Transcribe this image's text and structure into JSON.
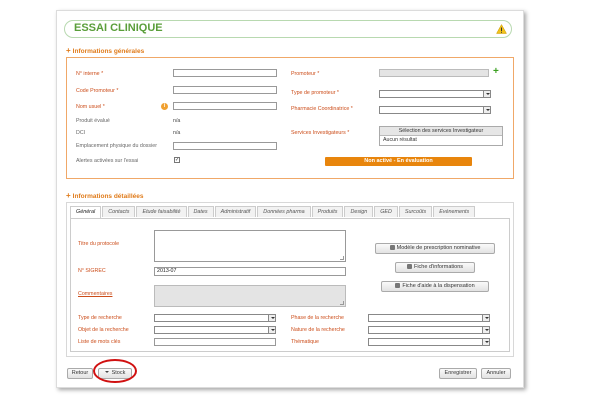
{
  "page": {
    "title": "ESSAI CLINIQUE"
  },
  "general": {
    "heading": "Informations générales",
    "left": {
      "num_interne_label": "N° interne *",
      "code_promoteur_label": "Code Promoteur *",
      "nom_usuel_label": "Nom usuel *",
      "produit_evalue_label": "Produit évalué",
      "produit_evalue_value": "n/a",
      "dci_label": "DCI",
      "dci_value": "n/a",
      "emplacement_label": "Emplacement physique du dossier",
      "alertes_label": "Alertes activées sur l'essai",
      "alertes_checked": true
    },
    "right": {
      "promoteur_label": "Promoteur *",
      "type_promoteur_label": "Type de promoteur *",
      "pharmacie_label": "Pharmacie Coordinatrice *",
      "services_label": "Services Investigateurs *",
      "services_table_header": "Sélection des services Investigateur",
      "services_table_row": "Aucun résultat",
      "status": "Non activé - En évaluation"
    }
  },
  "detailed": {
    "heading": "Informations détaillées",
    "tabs": [
      "Général",
      "Contacts",
      "Etude faisabilité",
      "Dates",
      "Administratif",
      "Données pharma",
      "Produits",
      "Design",
      "GED",
      "Surcoûts",
      "Evénements"
    ],
    "titre_label": "Titre du protocole",
    "sigrec_label": "N° SIGREC",
    "sigrec_value": "2013-07",
    "commentaires_label": "Commentaires",
    "buttons": {
      "modele": "Modèle de prescription nominative",
      "fiche_info": "Fiche d'informations",
      "fiche_aide": "Fiche d'aide à la dispensation"
    },
    "type_recherche_label": "Type de recherche",
    "objet_recherche_label": "Objet de la recherche",
    "mots_cles_label": "Liste de mots clés",
    "phase_label": "Phase de la recherche",
    "nature_label": "Nature de la recherche",
    "thematique_label": "Thématique"
  },
  "footer": {
    "retour": "Retour",
    "stock": "Stock",
    "enregistrer": "Enregistrer",
    "annuler": "Annuler"
  },
  "colors": {
    "accent": "#e07b1a",
    "title_green": "#5a9e3a",
    "status_orange": "#e8850c",
    "highlight_red": "#d01010"
  },
  "icons": [
    "warning-icon",
    "info-icon",
    "add-icon",
    "dropdown-arrow-icon",
    "document-icon",
    "caret-down-icon"
  ]
}
